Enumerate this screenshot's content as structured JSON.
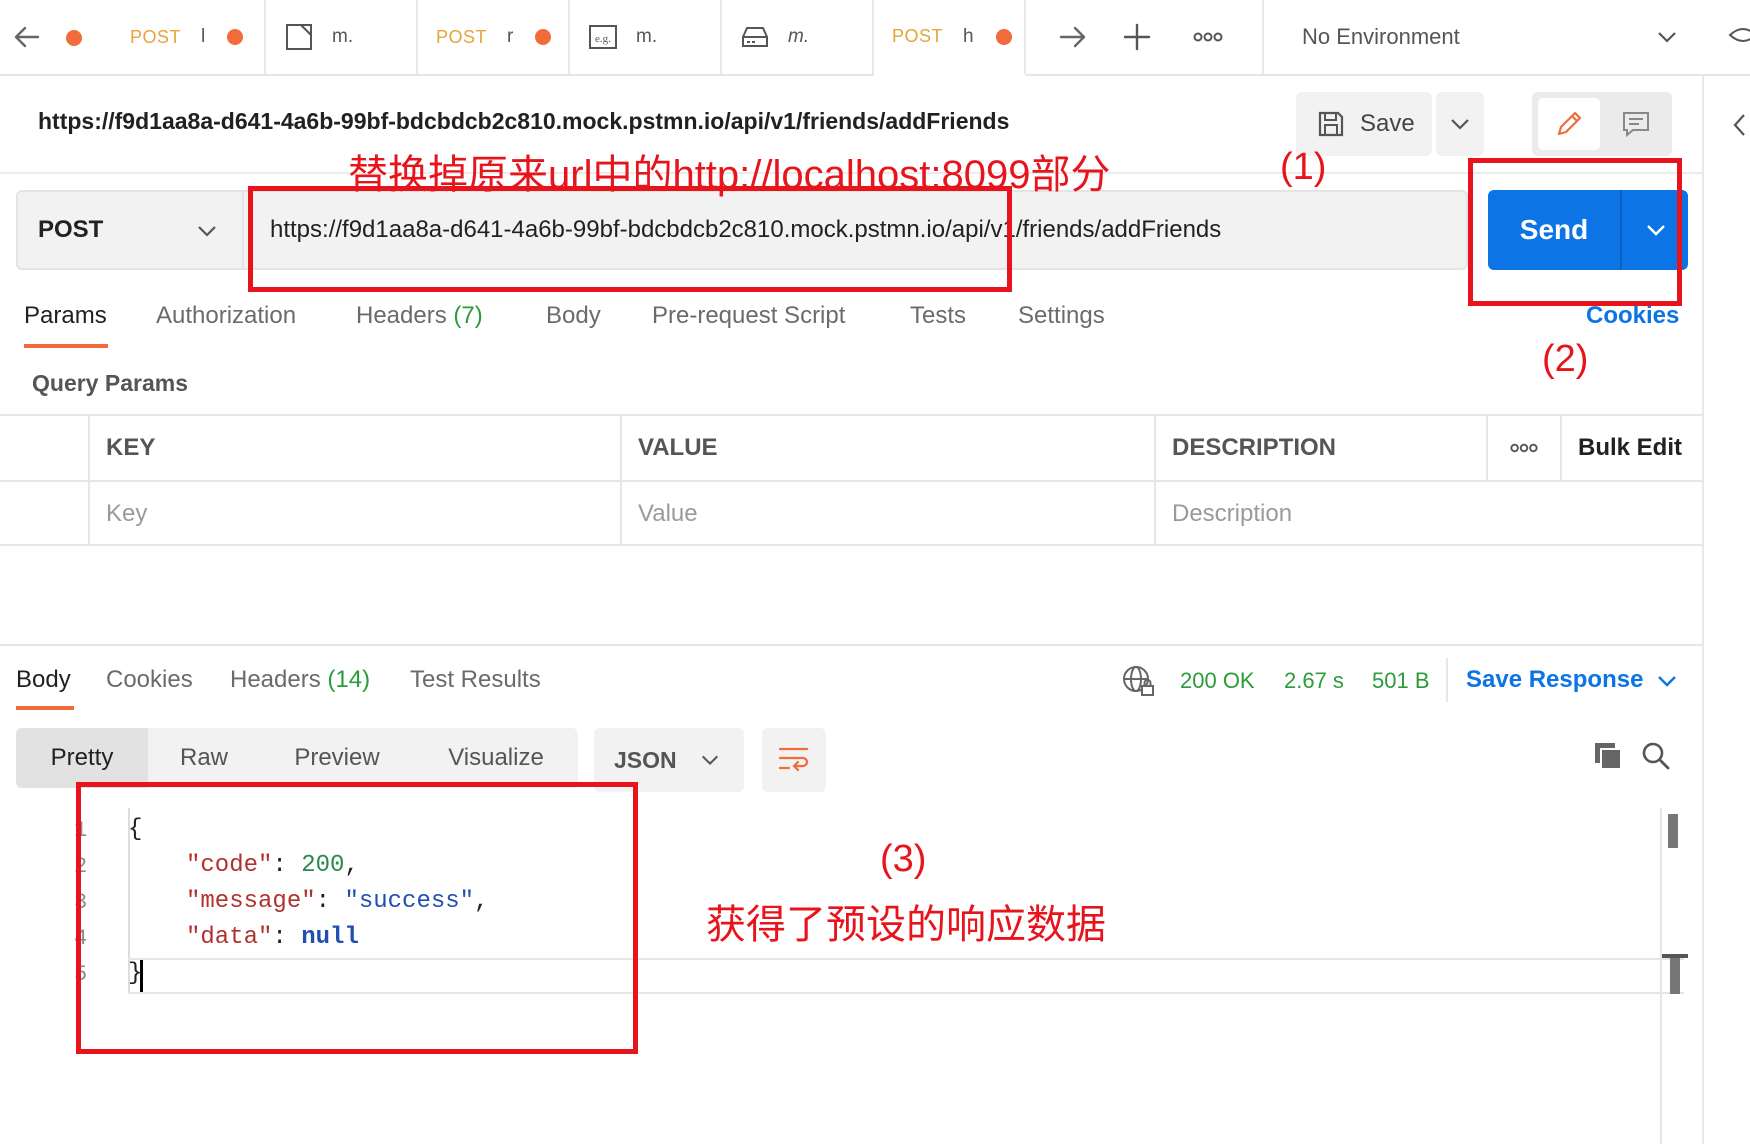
{
  "tabs": [
    {
      "method": "POST",
      "name": "l"
    },
    {
      "method": "",
      "name": "m."
    },
    {
      "method": "POST",
      "name": "r"
    },
    {
      "method": "",
      "name": "m."
    },
    {
      "method": "",
      "name": "m."
    },
    {
      "method": "POST",
      "name": "h"
    }
  ],
  "environment": "No Environment",
  "request": {
    "title": "https://f9d1aa8a-d641-4a6b-99bf-bdcbdcb2c810.mock.pstmn.io/api/v1/friends/addFriends",
    "save_label": "Save",
    "method": "POST",
    "url": "https://f9d1aa8a-d641-4a6b-99bf-bdcbdcb2c810.mock.pstmn.io/api/v1/friends/addFriends",
    "send_label": "Send",
    "subtabs": [
      "Params",
      "Authorization",
      "Headers",
      "Body",
      "Pre-request Script",
      "Tests",
      "Settings"
    ],
    "headers_count": "(7)",
    "cookies_label": "Cookies",
    "query_params_label": "Query Params",
    "table": {
      "columns": [
        "KEY",
        "VALUE",
        "DESCRIPTION"
      ],
      "more_label": "ooo",
      "bulk_edit_label": "Bulk Edit",
      "placeholders": [
        "Key",
        "Value",
        "Description"
      ]
    }
  },
  "response": {
    "tabs": [
      "Body",
      "Cookies",
      "Headers",
      "Test Results"
    ],
    "headers_count": "(14)",
    "status": "200 OK",
    "time": "2.67 s",
    "size": "501 B",
    "save_response_label": "Save Response",
    "views": [
      "Pretty",
      "Raw",
      "Preview",
      "Visualize"
    ],
    "format": "JSON",
    "body_lines": [
      {
        "num": "1",
        "text": "{"
      },
      {
        "num": "2",
        "key": "\"code\"",
        "sep": ": ",
        "val": "200",
        "end": ","
      },
      {
        "num": "3",
        "key": "\"message\"",
        "sep": ": ",
        "val": "\"success\"",
        "end": ","
      },
      {
        "num": "4",
        "key": "\"data\"",
        "sep": ": ",
        "val": "null",
        "end": ""
      },
      {
        "num": "5",
        "text": "}"
      }
    ]
  },
  "annotations": {
    "a1_text": "替换掉原来url中的http://localhost:8099部分",
    "a1_num": "(1)",
    "a2_num": "(2)",
    "a3_num": "(3)",
    "a3_text": "获得了预设的响应数据",
    "color": "#e8141c"
  },
  "colors": {
    "accent": "#f26b3a",
    "send": "#0c74e5",
    "status_ok": "#2a9d3a",
    "method_tab": "#e8a33a"
  }
}
